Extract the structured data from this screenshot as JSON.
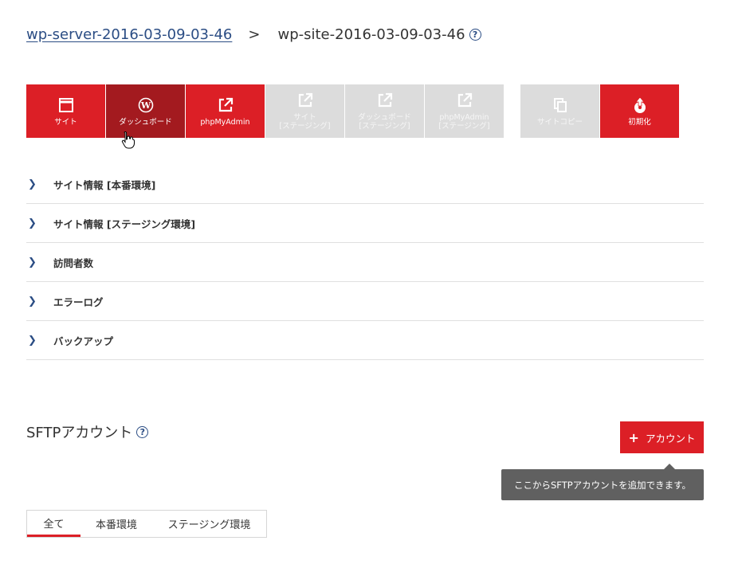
{
  "breadcrumb": {
    "server_link": "wp-server-2016-03-09-03-46 ",
    "separator": ">",
    "current": "wp-site-2016-03-09-03-46",
    "help": "?"
  },
  "toolbar": {
    "buttons": [
      {
        "label": "サイト",
        "icon": "window-icon",
        "state": "active"
      },
      {
        "label": "ダッシュボード",
        "icon": "wordpress-icon",
        "state": "pressed"
      },
      {
        "label": "phpMyAdmin",
        "icon": "external-link-icon",
        "state": "active"
      },
      {
        "label": "サイト\n[ステージング]",
        "icon": "external-link-icon",
        "state": "disabled"
      },
      {
        "label": "ダッシュボード\n[ステージング]",
        "icon": "external-link-icon",
        "state": "disabled"
      },
      {
        "label": "phpMyAdmin\n[ステージング]",
        "icon": "external-link-icon",
        "state": "disabled"
      },
      {
        "label": "サイトコピー",
        "icon": "copy-icon",
        "state": "disabled"
      },
      {
        "label": "初期化",
        "icon": "reset-disc-icon",
        "state": "active"
      }
    ]
  },
  "sections": [
    {
      "label": "サイト情報 [本番環境]"
    },
    {
      "label": "サイト情報 [ステージング環境]"
    },
    {
      "label": "訪問者数"
    },
    {
      "label": "エラーログ"
    },
    {
      "label": "バックアップ"
    }
  ],
  "chevron": "❯",
  "sftp": {
    "title": "SFTPアカウント",
    "help": "?",
    "add_button": "アカウント",
    "add_icon": "plus-icon",
    "tooltip": "ここからSFTPアカウントを追加できます。"
  },
  "tabs": [
    {
      "label": "全て",
      "selected": true
    },
    {
      "label": "本番環境",
      "selected": false
    },
    {
      "label": "ステージング環境",
      "selected": false
    }
  ],
  "colors": {
    "accent": "#dc1f26",
    "accent_dark": "#a31a1f",
    "link": "#2b4d84",
    "disabled": "#dcdcdc"
  }
}
